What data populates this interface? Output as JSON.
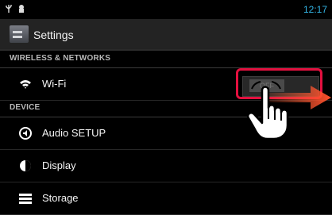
{
  "status": {
    "time": "12:17"
  },
  "header": {
    "title": "Settings",
    "icon": "settings-icon"
  },
  "sections": {
    "wireless": "WIRELESS & NETWORKS",
    "device": "DEVICE"
  },
  "items": {
    "wifi": {
      "label": "Wi-Fi",
      "toggle": "OFF"
    },
    "audio": {
      "label": "Audio SETUP"
    },
    "display": {
      "label": "Display"
    },
    "storage": {
      "label": "Storage"
    }
  },
  "colors": {
    "accent": "#33b5e5",
    "highlight": "#e3103f",
    "arrow": "#ff6a3d"
  }
}
